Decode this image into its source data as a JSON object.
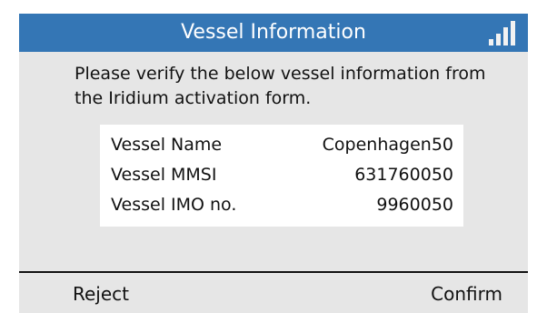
{
  "title_bar": {
    "title": "Vessel Information",
    "signal_icon": "signal-strength-icon",
    "signal_bars_lit": 4,
    "signal_bars_total": 4
  },
  "message": "Please verify the below vessel information from the Iridium activation form.",
  "vessel_info": [
    {
      "label": "Vessel Name",
      "value": "Copenhagen50"
    },
    {
      "label": "Vessel MMSI",
      "value": "631760050"
    },
    {
      "label": "Vessel IMO no.",
      "value": "9960050"
    }
  ],
  "softkeys": {
    "left_label": "Reject",
    "right_label": "Confirm"
  },
  "colors": {
    "title_bar_bg": "#3476b5",
    "screen_bg": "#e6e6e6",
    "info_box_bg": "#ffffff",
    "signal_bar": "#f2f2f2"
  }
}
